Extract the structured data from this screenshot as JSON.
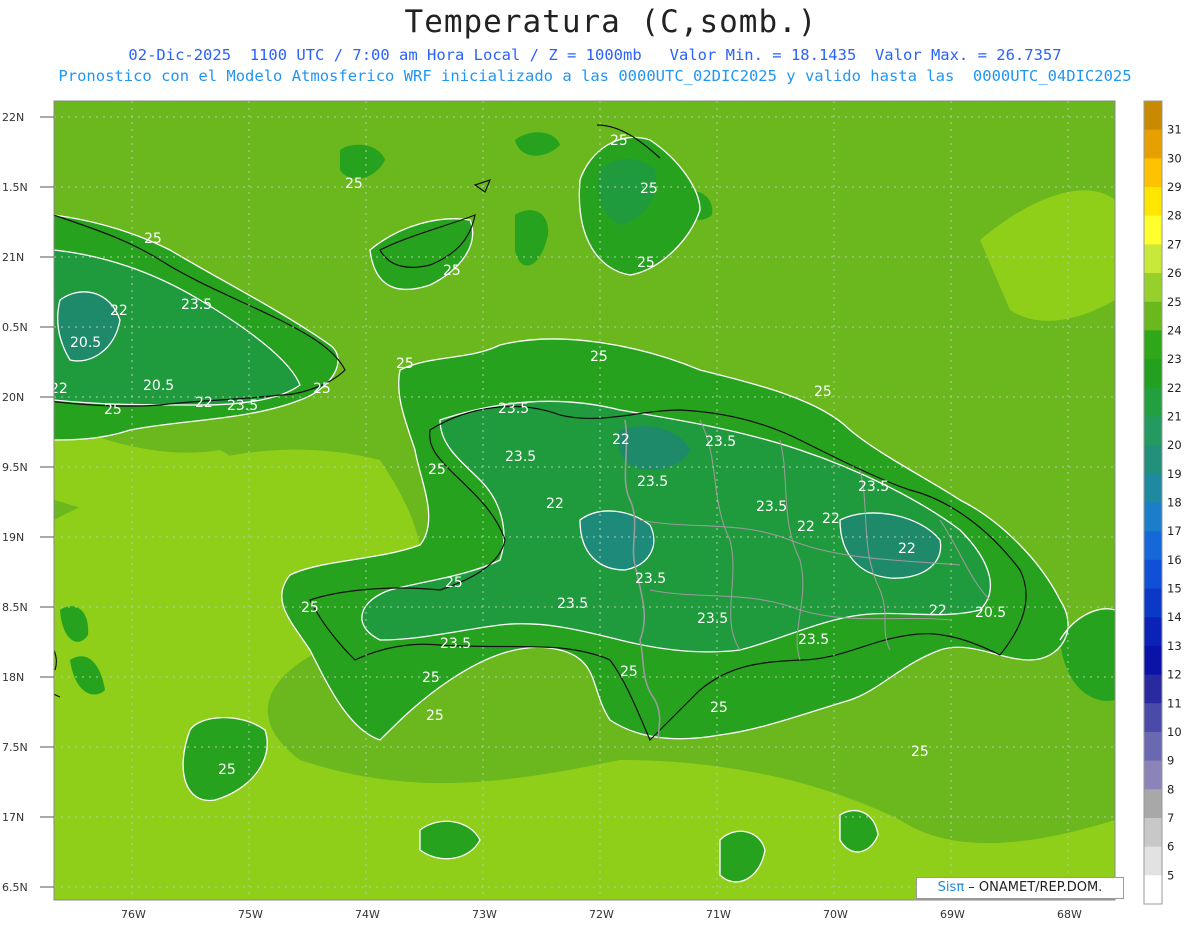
{
  "header": {
    "title": "Temperatura (C,somb.)",
    "subtitle1": "02-Dic-2025  1100 UTC / 7:00 am Hora Local / Z = 1000mb   Valor Min. = 18.1435  Valor Max. = 26.7357",
    "subtitle2": "Pronostico con el Modelo Atmosferico WRF inicializado a las 0000UTC_02DIC2025 y valido hasta las  0000UTC_04DIC2025"
  },
  "map": {
    "lat_labels": [
      "22N",
      "1.5N",
      "21N",
      "0.5N",
      "20N",
      "9.5N",
      "19N",
      "8.5N",
      "18N",
      "7.5N",
      "17N",
      "6.5N"
    ],
    "lon_labels": [
      "76W",
      "75W",
      "74W",
      "73W",
      "72W",
      "71W",
      "70W",
      "69W",
      "68W"
    ],
    "contour_labels": [
      "25",
      "25",
      "25",
      "25",
      "25",
      "25",
      "25",
      "25",
      "25",
      "25",
      "25",
      "25",
      "25",
      "25",
      "25",
      "25",
      "25",
      "25",
      "25",
      "25",
      "22",
      "22",
      "22",
      "22",
      "22",
      "22",
      "22",
      "22",
      "22",
      "23.5",
      "23.5",
      "23.5",
      "23.5",
      "23.5",
      "23.5",
      "23.5",
      "23.5",
      "23.5",
      "23.5",
      "23.5",
      "23.5",
      "23.5",
      "20.5",
      "20.5",
      "20.5"
    ]
  },
  "colorbar": {
    "levels": [
      "31",
      "30",
      "29",
      "28",
      "27",
      "26",
      "25",
      "24",
      "23",
      "22",
      "21",
      "20",
      "19",
      "18",
      "17",
      "16",
      "15",
      "14",
      "13",
      "12",
      "11",
      "10",
      "9",
      "8",
      "7",
      "6",
      "5"
    ],
    "colors": [
      "#c88a00",
      "#e8a000",
      "#ffc200",
      "#ffe600",
      "#ffff2e",
      "#c8e83a",
      "#96d02a",
      "#6ab81e",
      "#2ea818",
      "#24a020",
      "#22a040",
      "#249a60",
      "#22907a",
      "#1e8aa0",
      "#1a7ec8",
      "#1568d8",
      "#1050d8",
      "#0c38c8",
      "#0a22b8",
      "#0a12a8",
      "#2a2aa0",
      "#4a4aa8",
      "#6a68b0",
      "#8a84b8",
      "#a8a8a8",
      "#c8c8c8",
      "#e2e2e2",
      "#ffffff"
    ]
  },
  "credit": {
    "sis": "Sis",
    "pi": "π",
    "text": "– ONAMET/REP.DOM."
  }
}
